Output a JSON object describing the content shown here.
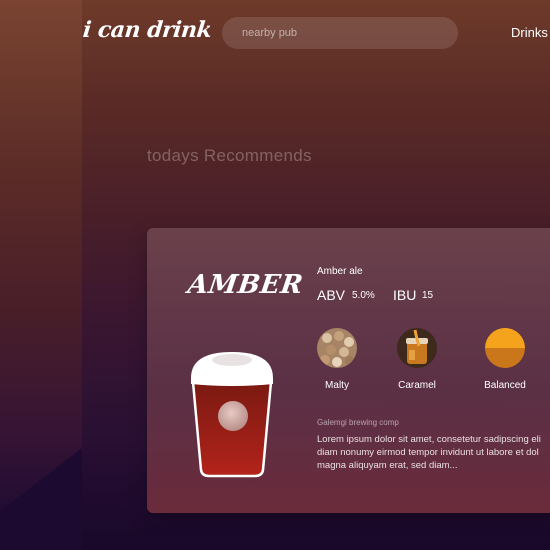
{
  "header": {
    "logo": "i can drink",
    "search_placeholder": "nearby pub",
    "nav_drinks": "Drinks"
  },
  "section": {
    "title": "todays Recommends"
  },
  "card": {
    "name": "AMBER",
    "style": "Amber ale",
    "abv_label": "ABV",
    "abv_value": "5.0%",
    "ibu_label": "IBU",
    "ibu_value": "15",
    "flavors": [
      {
        "label": "Malty",
        "icon": "malt-grain-icon"
      },
      {
        "label": "Caramel",
        "icon": "caramel-jar-icon"
      },
      {
        "label": "Balanced",
        "icon": "balance-circle-icon"
      }
    ],
    "brewer": "Galemgi brewing comp",
    "description_lines": [
      "Lorem ipsum dolor sit amet, consetetur sadipscing eli",
      "diam nonumy eirmod tempor invidunt ut labore et dol",
      "magna aliquyam erat, sed diam..."
    ]
  },
  "colors": {
    "beer": "#a31f14",
    "foam": "#ffffff",
    "balanced_top": "#f5a31d",
    "balanced_bottom": "#c9771a"
  }
}
